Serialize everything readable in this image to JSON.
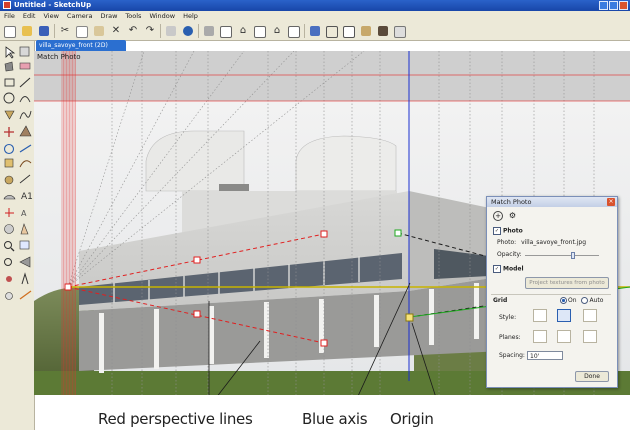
{
  "window": {
    "title": "Untitled - SketchUp"
  },
  "menu": [
    "File",
    "Edit",
    "View",
    "Camera",
    "Draw",
    "Tools",
    "Window",
    "Help"
  ],
  "toolbar": {
    "icons": [
      "new-icon",
      "open-icon",
      "save-icon",
      "cut-icon",
      "copy-icon",
      "paste-icon",
      "erase-icon",
      "undo-icon",
      "redo-icon",
      "print-icon",
      "model-info-icon",
      "iso-view-icon",
      "top-view-icon",
      "front-view-icon",
      "right-view-icon",
      "back-view-icon",
      "left-view-icon",
      "xray-style-icon",
      "wireframe-style-icon",
      "hidden-line-style-icon",
      "shaded-style-icon",
      "textured-style-icon",
      "monochrome-style-icon"
    ]
  },
  "scene_tab": {
    "label": "villa_savoye_front (2D)"
  },
  "viewport": {
    "label": "Match Photo"
  },
  "match_photo": {
    "title": "Match Photo",
    "photo_section": "Photo",
    "photo_label": "Photo:",
    "photo_file": "villa_savoye_front.jpg",
    "opacity_label": "Opacity:",
    "opacity_value": 0.65,
    "model_section": "Model",
    "project_button": "Project textures from photo",
    "grid_label": "Grid",
    "grid_on": "On",
    "grid_auto": "Auto",
    "style_label": "Style:",
    "planes_label": "Planes:",
    "spacing_label": "Spacing:",
    "spacing_value": "10'",
    "done_button": "Done"
  },
  "captions": {
    "red_lines": "Red perspective lines",
    "blue_axis": "Blue axis",
    "origin": "Origin"
  },
  "colors": {
    "red_axis": "#e02020",
    "blue_axis": "#1a2fd0",
    "green_axis": "#1faa1f",
    "horizon": "#c8b400",
    "title_bar": "#1846a8"
  }
}
